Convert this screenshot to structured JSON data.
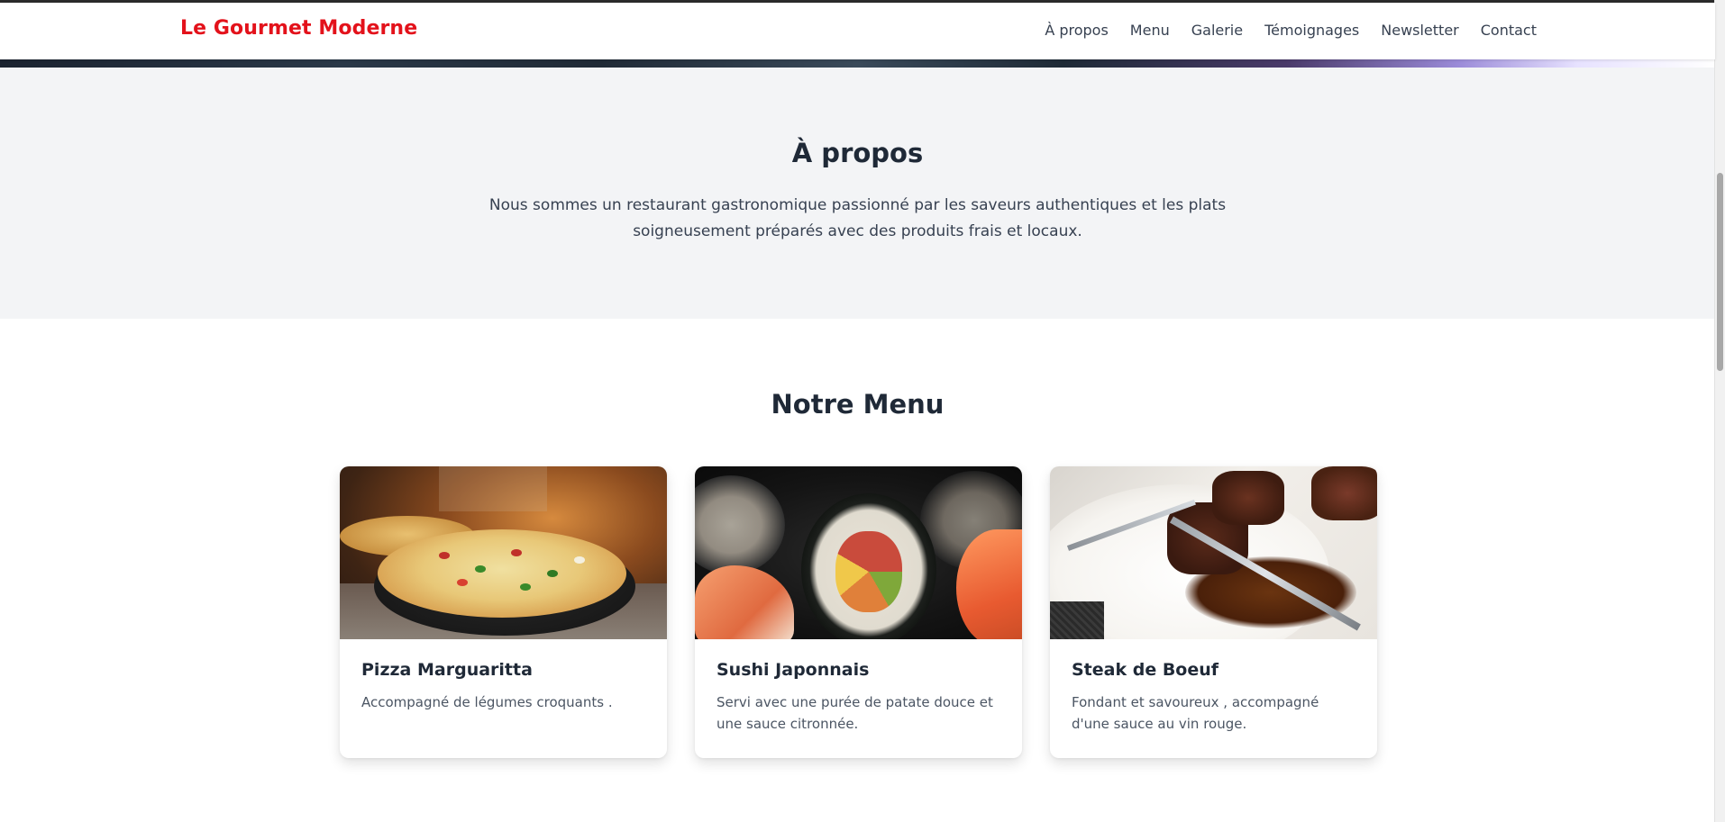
{
  "nav": {
    "brand": "Le Gourmet Moderne",
    "links": [
      "À propos",
      "Menu",
      "Galerie",
      "Témoignages",
      "Newsletter",
      "Contact"
    ]
  },
  "about": {
    "title": "À propos",
    "text": "Nous sommes un restaurant gastronomique passionné par les saveurs authentiques et les plats soigneusement préparés avec des produits frais et locaux."
  },
  "menu": {
    "title": "Notre Menu",
    "items": [
      {
        "name": "Pizza Marguaritta",
        "description": "Accompagné de légumes croquants ."
      },
      {
        "name": "Sushi Japonnais",
        "description": "Servi avec une purée de patate douce et une sauce citronnée."
      },
      {
        "name": "Steak de Boeuf",
        "description": "Fondant et savoureux , accompagné d'une sauce au vin rouge."
      }
    ]
  },
  "colors": {
    "brand": "#e3121b",
    "heading": "#1f2937",
    "about_bg": "#f3f4f6"
  }
}
